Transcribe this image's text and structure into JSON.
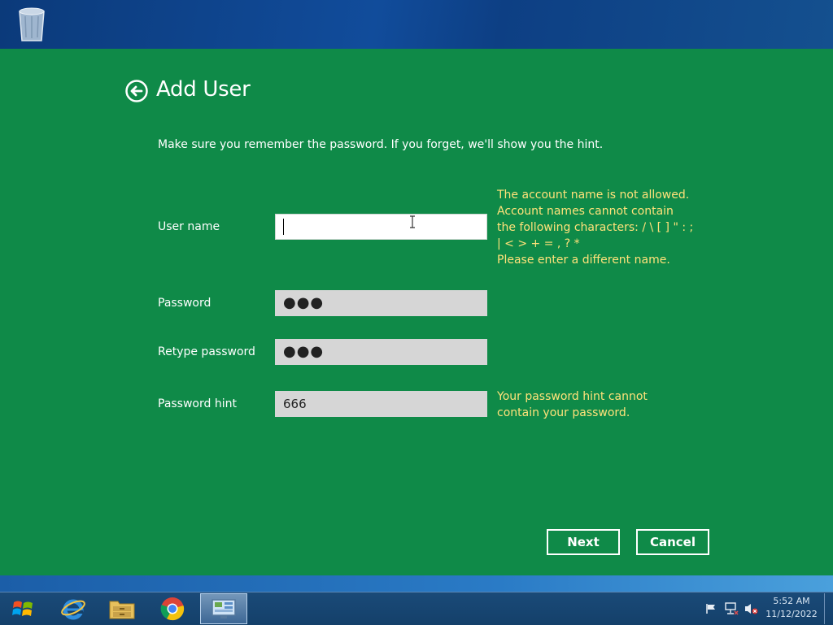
{
  "dialog": {
    "title": "Add User",
    "instruction": "Make sure you remember the password. If you forget, we'll show you the hint.",
    "fields": {
      "username": {
        "label": "User name",
        "value": ""
      },
      "password": {
        "label": "Password",
        "value": "●●●"
      },
      "retype": {
        "label": "Retype password",
        "value": "●●●"
      },
      "hint": {
        "label": "Password hint",
        "value": "666"
      }
    },
    "username_error": [
      "The account name is not allowed.",
      "Account names cannot contain",
      "the following characters: / \\ [ ] \" : ;",
      "| < > + = , ? *",
      "Please enter a different name."
    ],
    "hint_error": [
      "Your password hint cannot",
      "contain your password."
    ],
    "buttons": {
      "next": "Next",
      "cancel": "Cancel"
    }
  },
  "taskbar": {
    "apps": [
      "start-orb-icon",
      "internet-explorer-icon",
      "file-explorer-icon",
      "chrome-icon",
      "control-panel-icon"
    ],
    "clock": {
      "time": "5:52 AM",
      "date": "11/12/2022"
    }
  },
  "colors": {
    "panel": "#0f8a48",
    "warning_text": "#ffe27a",
    "desktop": "#0d3f86"
  }
}
